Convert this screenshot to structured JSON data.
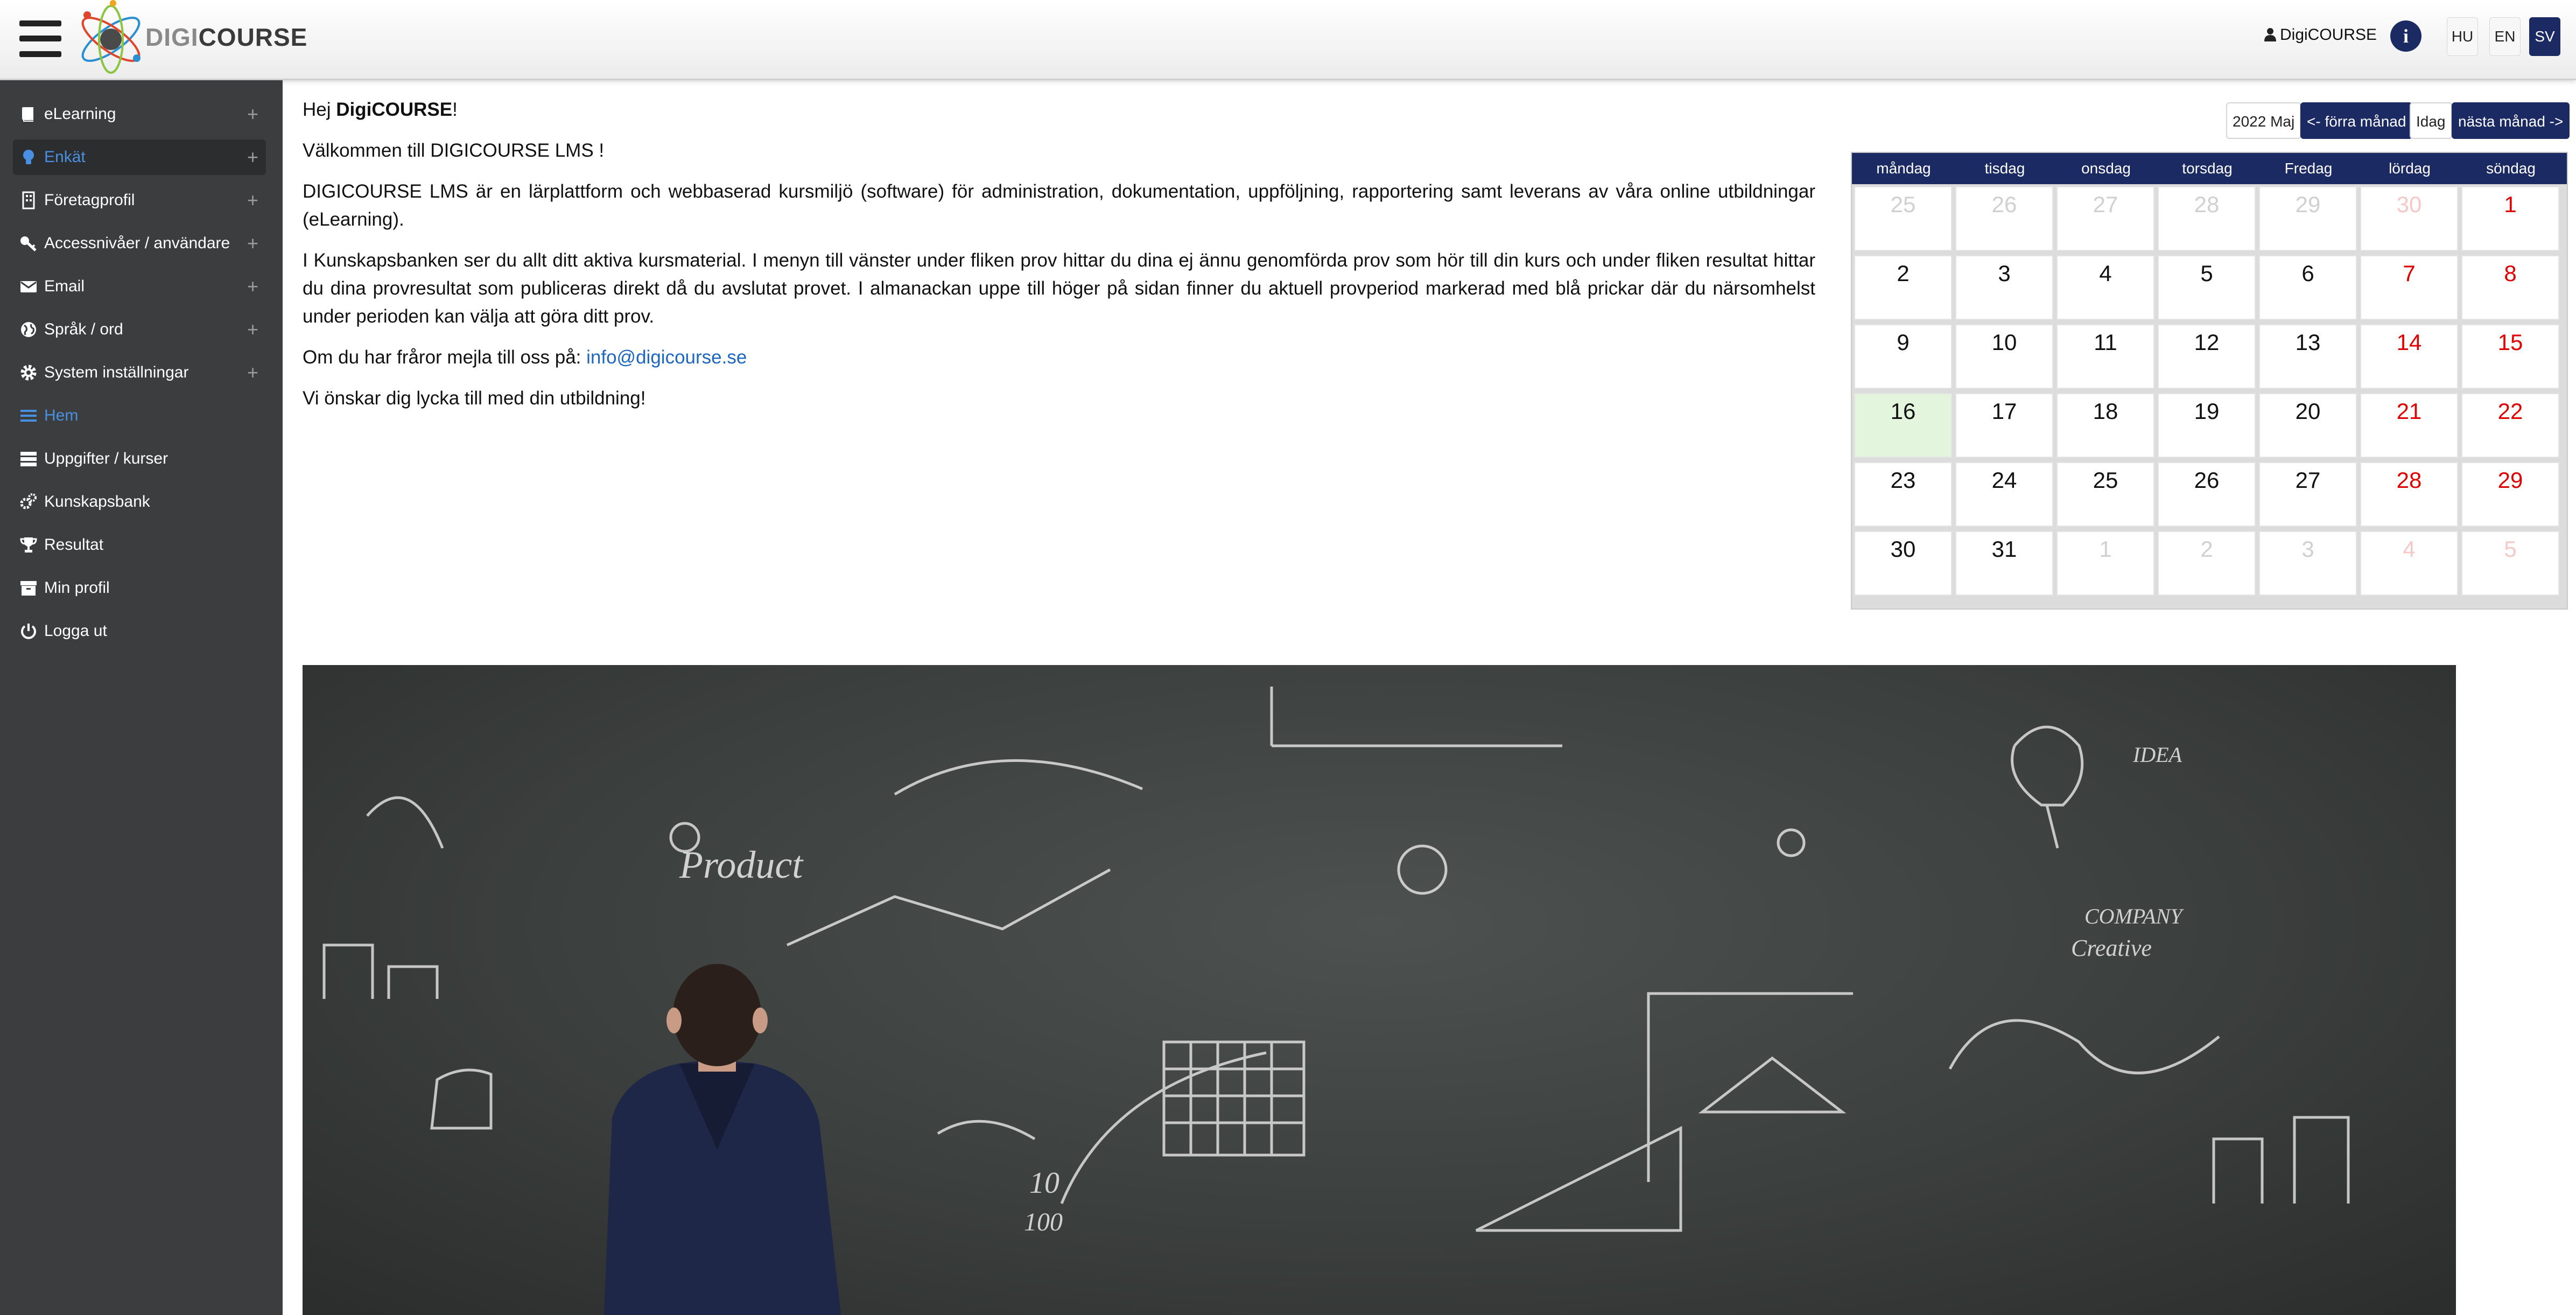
{
  "header": {
    "logo_light": "DIGI",
    "logo_dark": "COURSE",
    "user": "DigiCOURSE",
    "info_icon": "i",
    "languages": [
      "HU",
      "EN",
      "SV"
    ],
    "active_language": "SV"
  },
  "sidebar": {
    "items": [
      {
        "label": "eLearning",
        "icon": "book-icon",
        "expandable": true
      },
      {
        "label": "Enkät",
        "icon": "lightbulb-icon",
        "expandable": true
      },
      {
        "label": "Företagprofil",
        "icon": "building-icon",
        "expandable": true
      },
      {
        "label": "Accessnivåer / användare",
        "icon": "key-icon",
        "expandable": true
      },
      {
        "label": "Email",
        "icon": "envelope-icon",
        "expandable": true
      },
      {
        "label": "Språk / ord",
        "icon": "globe-icon",
        "expandable": true
      },
      {
        "label": "System inställningar",
        "icon": "gear-icon",
        "expandable": true
      },
      {
        "label": "Hem",
        "icon": "list-icon",
        "expandable": false
      },
      {
        "label": "Uppgifter / kurser",
        "icon": "tasks-icon",
        "expandable": false
      },
      {
        "label": "Kunskapsbank",
        "icon": "gears-icon",
        "expandable": false
      },
      {
        "label": "Resultat",
        "icon": "trophy-icon",
        "expandable": false
      },
      {
        "label": "Min profil",
        "icon": "archive-icon",
        "expandable": false
      },
      {
        "label": "Logga ut",
        "icon": "power-icon",
        "expandable": false
      }
    ]
  },
  "main": {
    "greeting_prefix": "Hej ",
    "greeting_name": "DigiCOURSE",
    "greeting_suffix": "!",
    "welcome": "Välkommen till DIGICOURSE LMS !",
    "para1": "DIGICOURSE LMS är en lärplattform och webbaserad kursmiljö (software) för administration, dokumentation, uppföljning, rapportering samt leverans av våra online utbildningar (eLearning).",
    "para2": "I Kunskapsbanken ser du allt ditt aktiva kursmaterial. I menyn till vänster under fliken prov hittar du dina ej ännu genomförda prov som hör till din kurs och under fliken resultat hittar du dina provresultat som publiceras direkt då du avslutat provet. I almanackan uppe till höger på sidan finner du aktuell provperiod markerad med blå prickar där du närsomhelst under perioden kan välja att göra ditt prov.",
    "contact_prefix": "Om du har fråror mejla till oss på: ",
    "contact_email": "info@digicourse.se",
    "closing": "Vi önskar dig lycka till med din utbildning!"
  },
  "calendar": {
    "month_label": "2022 Maj",
    "prev_label": "<- förra månad",
    "today_label": "Idag",
    "next_label": "nästa månad ->",
    "weekdays": [
      "måndag",
      "tisdag",
      "onsdag",
      "torsdag",
      "Fredag",
      "lördag",
      "söndag"
    ],
    "weeks": [
      [
        "25",
        "26",
        "27",
        "28",
        "29",
        "30",
        "1"
      ],
      [
        "2",
        "3",
        "4",
        "5",
        "6",
        "7",
        "8"
      ],
      [
        "9",
        "10",
        "11",
        "12",
        "13",
        "14",
        "15"
      ],
      [
        "16",
        "17",
        "18",
        "19",
        "20",
        "21",
        "22"
      ],
      [
        "23",
        "24",
        "25",
        "26",
        "27",
        "28",
        "29"
      ],
      [
        "30",
        "31",
        "1",
        "2",
        "3",
        "4",
        "5"
      ]
    ],
    "today": "16"
  },
  "hero": {
    "chalk": {
      "product": "Product",
      "idea": "IDEA",
      "company": "COMPANY",
      "creative": "Creative",
      "fraction_top": "10",
      "fraction_bottom": "100"
    }
  }
}
